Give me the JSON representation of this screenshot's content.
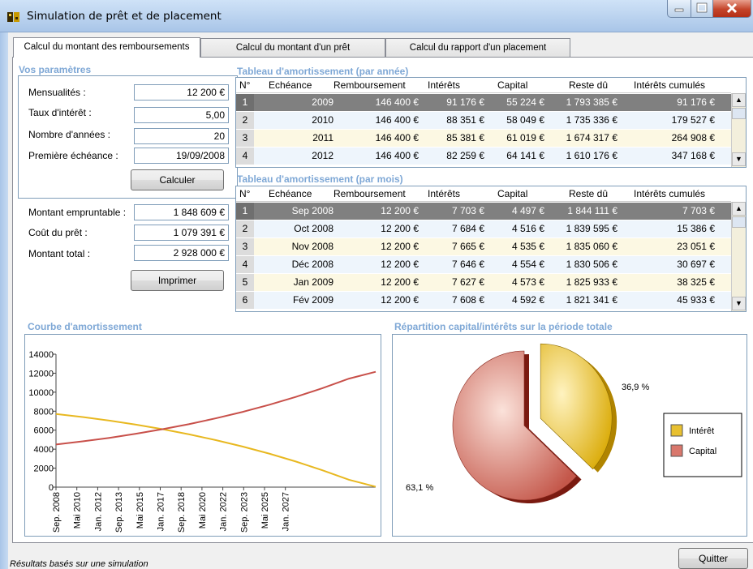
{
  "window": {
    "title": "Simulation de prêt et de placement"
  },
  "tabs": [
    {
      "label": "Calcul du montant des remboursements"
    },
    {
      "label": "Calcul du montant d'un prêt"
    },
    {
      "label": "Calcul du rapport d'un placement"
    }
  ],
  "params": {
    "section_title": "Vos paramètres",
    "mensualites_label": "Mensualités :",
    "mensualites_value": "12 200 €",
    "taux_label": "Taux d'intérêt :",
    "taux_value": "5,00",
    "annees_label": "Nombre d'années :",
    "annees_value": "20",
    "echeance_label": "Première échéance :",
    "echeance_value": "19/09/2008",
    "calculer_label": "Calculer"
  },
  "results": {
    "empruntable_label": "Montant empruntable :",
    "empruntable_value": "1 848 609 €",
    "cout_label": "Coût du prêt :",
    "cout_value": "1 079 391 €",
    "total_label": "Montant total :",
    "total_value": "2 928 000 €",
    "imprimer_label": "Imprimer"
  },
  "annual_table": {
    "title": "Tableau d'amortissement (par année)",
    "columns": [
      "N°",
      "Echéance",
      "Remboursement",
      "Intérêts",
      "Capital",
      "Reste dû",
      "Intérêts cumulés"
    ],
    "rows": [
      [
        "1",
        "2009",
        "146 400 €",
        "91 176 €",
        "55 224 €",
        "1 793 385 €",
        "91 176 €"
      ],
      [
        "2",
        "2010",
        "146 400 €",
        "88 351 €",
        "58 049 €",
        "1 735 336 €",
        "179 527 €"
      ],
      [
        "3",
        "2011",
        "146 400 €",
        "85 381 €",
        "61 019 €",
        "1 674 317 €",
        "264 908 €"
      ],
      [
        "4",
        "2012",
        "146 400 €",
        "82 259 €",
        "64 141 €",
        "1 610 176 €",
        "347 168 €"
      ]
    ]
  },
  "monthly_table": {
    "title": "Tableau d'amortissement (par mois)",
    "columns": [
      "N°",
      "Echéance",
      "Remboursement",
      "Intérêts",
      "Capital",
      "Reste dû",
      "Intérêts cumulés"
    ],
    "rows": [
      [
        "1",
        "Sep 2008",
        "12 200 €",
        "7 703 €",
        "4 497 €",
        "1 844 111 €",
        "7 703 €"
      ],
      [
        "2",
        "Oct 2008",
        "12 200 €",
        "7 684 €",
        "4 516 €",
        "1 839 595 €",
        "15 386 €"
      ],
      [
        "3",
        "Nov 2008",
        "12 200 €",
        "7 665 €",
        "4 535 €",
        "1 835 060 €",
        "23 051 €"
      ],
      [
        "4",
        "Déc 2008",
        "12 200 €",
        "7 646 €",
        "4 554 €",
        "1 830 506 €",
        "30 697 €"
      ],
      [
        "5",
        "Jan 2009",
        "12 200 €",
        "7 627 €",
        "4 573 €",
        "1 825 933 €",
        "38 325 €"
      ],
      [
        "6",
        "Fév 2009",
        "12 200 €",
        "7 608 €",
        "4 592 €",
        "1 821 341 €",
        "45 933 €"
      ]
    ]
  },
  "charts": {
    "line_title": "Courbe d'amortissement",
    "pie_title": "Répartition capital/intérêts sur la période totale"
  },
  "chart_data": [
    {
      "type": "line",
      "title": "Courbe d'amortissement",
      "x": [
        "Sep. 2008",
        "Mai 2010",
        "Jan. 2012",
        "Sep. 2013",
        "Mai 2015",
        "Jan. 2017",
        "Sep. 2018",
        "Mai 2020",
        "Jan. 2022",
        "Sep. 2023",
        "Mai 2025",
        "Jan. 2027"
      ],
      "ylim": [
        0,
        14000
      ],
      "yticks": [
        0,
        2000,
        4000,
        6000,
        8000,
        10000,
        12000,
        14000
      ],
      "series": [
        {
          "values": [
            7703,
            7380,
            7010,
            6580,
            6100,
            5560,
            4950,
            4280,
            3530,
            2700,
            1780,
            770,
            50
          ],
          "color": "#e8b820"
        },
        {
          "values": [
            4497,
            4820,
            5190,
            5620,
            6100,
            6640,
            7250,
            7920,
            8670,
            9500,
            10420,
            11430,
            12150
          ],
          "color": "#c8504a"
        }
      ]
    },
    {
      "type": "pie",
      "title": "Répartition capital/intérêts sur la période totale",
      "slices": [
        {
          "name": "Intérêt",
          "value": 36.9,
          "label": "36,9 %",
          "color": "#e8c030"
        },
        {
          "name": "Capital",
          "value": 63.1,
          "label": "63,1 %",
          "color": "#d9776c"
        }
      ],
      "legend": "right"
    }
  ],
  "footer": {
    "status": "Résultats basés sur une simulation",
    "quitter_label": "Quitter"
  }
}
